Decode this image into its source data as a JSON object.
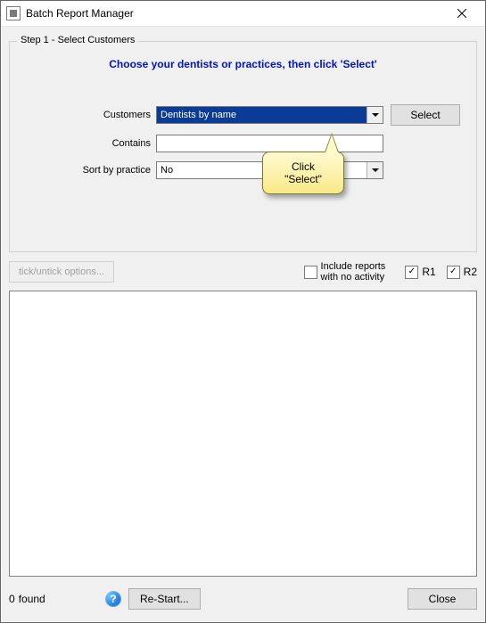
{
  "window": {
    "title": "Batch Report Manager"
  },
  "step1": {
    "legend": "Step 1 - Select Customers",
    "instruction": "Choose your dentists or practices, then click 'Select'",
    "labels": {
      "customers": "Customers",
      "contains": "Contains",
      "sort_by_practice": "Sort by practice"
    },
    "customers_combo": {
      "selected": "Dentists by name"
    },
    "contains_value": "",
    "sort_combo": {
      "selected": "No"
    },
    "select_button": "Select"
  },
  "options": {
    "tick_button": "tick/untick options...",
    "include_no_activity": {
      "checked": false,
      "label": "Include reports\nwith no activity"
    },
    "r1": {
      "checked": true,
      "label": "R1"
    },
    "r2": {
      "checked": true,
      "label": "R2"
    }
  },
  "callout": {
    "line1": "Click",
    "line2": "\"Select\""
  },
  "footer": {
    "count": "0",
    "found_label": "found",
    "restart_button": "Re-Start...",
    "close_button": "Close"
  },
  "icons": {
    "help": "?"
  }
}
